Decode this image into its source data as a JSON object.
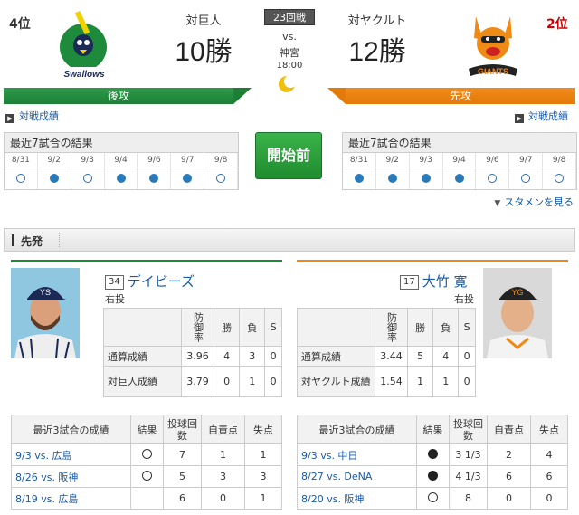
{
  "header": {
    "left_rank": "4位",
    "right_rank": "2位",
    "left_vs_label": "対巨人",
    "left_wins": "10勝",
    "right_vs_label": "対ヤクルト",
    "right_wins": "12勝",
    "round": "23回戦",
    "vs": "vs.",
    "venue": "神宮",
    "time": "18:00",
    "left_batting": "後攻",
    "right_batting": "先攻",
    "left_logo_text": "Swallows",
    "right_logo_text": "GIANTS",
    "left_color": "#1e8a3c",
    "right_color": "#ee8a16"
  },
  "links": {
    "left_record": "対戦成績",
    "right_record": "対戦成績",
    "stamen": "スタメンを見る"
  },
  "start_button": "開始前",
  "recent7": {
    "title": "最近7試合の結果",
    "dates": [
      "8/31",
      "9/2",
      "9/3",
      "9/4",
      "9/6",
      "9/7",
      "9/8"
    ],
    "left_results": [
      "win",
      "loss",
      "win",
      "loss",
      "loss",
      "loss",
      "win"
    ],
    "right_results": [
      "loss",
      "loss",
      "loss",
      "loss",
      "win",
      "win",
      "win"
    ]
  },
  "sensen": {
    "label": "先発"
  },
  "left_pitcher": {
    "number": "34",
    "name": "デイビーズ",
    "hand": "右投",
    "stats_headers": [
      "防御率",
      "勝",
      "負",
      "S"
    ],
    "rows": [
      {
        "label": "通算成績",
        "vals": [
          "3.96",
          "4",
          "3",
          "0"
        ]
      },
      {
        "label": "対巨人成績",
        "vals": [
          "3.79",
          "0",
          "1",
          "0"
        ]
      }
    ],
    "recent_title": "最近3試合の成績",
    "recent_headers": [
      "結果",
      "投球回数",
      "自責点",
      "失点"
    ],
    "recent": [
      {
        "opp": "9/3 vs. 広島",
        "result": "win",
        "ip": "7",
        "er": "1",
        "r": "1"
      },
      {
        "opp": "8/26 vs. 阪神",
        "result": "win",
        "ip": "5",
        "er": "3",
        "r": "3"
      },
      {
        "opp": "8/19 vs. 広島",
        "result": "",
        "ip": "6",
        "er": "0",
        "r": "1"
      }
    ]
  },
  "right_pitcher": {
    "number": "17",
    "name": "大竹 寛",
    "hand": "右投",
    "stats_headers": [
      "防御率",
      "勝",
      "負",
      "S"
    ],
    "rows": [
      {
        "label": "通算成績",
        "vals": [
          "3.44",
          "5",
          "4",
          "0"
        ]
      },
      {
        "label": "対ヤクルト成績",
        "vals": [
          "1.54",
          "1",
          "1",
          "0"
        ]
      }
    ],
    "recent_title": "最近3試合の成績",
    "recent_headers": [
      "結果",
      "投球回数",
      "自責点",
      "失点"
    ],
    "recent": [
      {
        "opp": "9/3 vs. 中日",
        "result": "loss",
        "ip": "3 1/3",
        "er": "2",
        "r": "4"
      },
      {
        "opp": "8/27 vs. DeNA",
        "result": "loss",
        "ip": "4 1/3",
        "er": "6",
        "r": "6"
      },
      {
        "opp": "8/20 vs. 阪神",
        "result": "win",
        "ip": "8",
        "er": "0",
        "r": "0"
      }
    ]
  }
}
